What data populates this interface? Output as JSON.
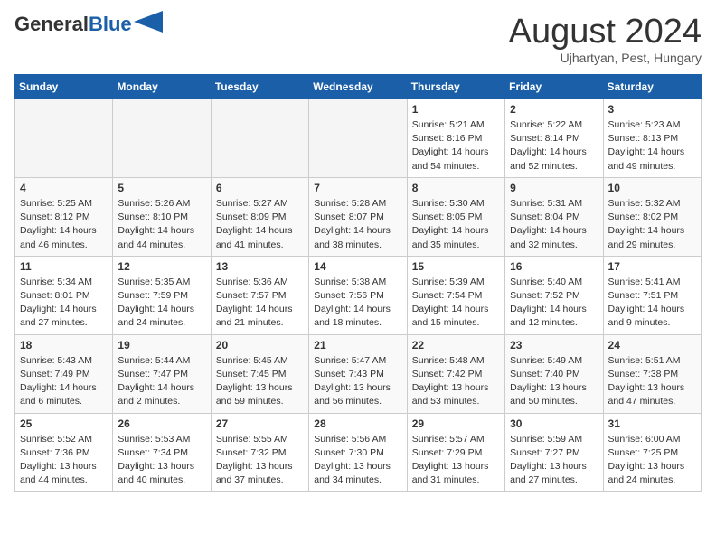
{
  "header": {
    "logo_general": "General",
    "logo_blue": "Blue",
    "month": "August 2024",
    "location": "Ujhartyan, Pest, Hungary"
  },
  "days_of_week": [
    "Sunday",
    "Monday",
    "Tuesday",
    "Wednesday",
    "Thursday",
    "Friday",
    "Saturday"
  ],
  "weeks": [
    [
      {
        "day": "",
        "empty": true
      },
      {
        "day": "",
        "empty": true
      },
      {
        "day": "",
        "empty": true
      },
      {
        "day": "",
        "empty": true
      },
      {
        "day": "1",
        "sunrise": "5:21 AM",
        "sunset": "8:16 PM",
        "daylight": "14 hours and 54 minutes."
      },
      {
        "day": "2",
        "sunrise": "5:22 AM",
        "sunset": "8:14 PM",
        "daylight": "14 hours and 52 minutes."
      },
      {
        "day": "3",
        "sunrise": "5:23 AM",
        "sunset": "8:13 PM",
        "daylight": "14 hours and 49 minutes."
      }
    ],
    [
      {
        "day": "4",
        "sunrise": "5:25 AM",
        "sunset": "8:12 PM",
        "daylight": "14 hours and 46 minutes."
      },
      {
        "day": "5",
        "sunrise": "5:26 AM",
        "sunset": "8:10 PM",
        "daylight": "14 hours and 44 minutes."
      },
      {
        "day": "6",
        "sunrise": "5:27 AM",
        "sunset": "8:09 PM",
        "daylight": "14 hours and 41 minutes."
      },
      {
        "day": "7",
        "sunrise": "5:28 AM",
        "sunset": "8:07 PM",
        "daylight": "14 hours and 38 minutes."
      },
      {
        "day": "8",
        "sunrise": "5:30 AM",
        "sunset": "8:05 PM",
        "daylight": "14 hours and 35 minutes."
      },
      {
        "day": "9",
        "sunrise": "5:31 AM",
        "sunset": "8:04 PM",
        "daylight": "14 hours and 32 minutes."
      },
      {
        "day": "10",
        "sunrise": "5:32 AM",
        "sunset": "8:02 PM",
        "daylight": "14 hours and 29 minutes."
      }
    ],
    [
      {
        "day": "11",
        "sunrise": "5:34 AM",
        "sunset": "8:01 PM",
        "daylight": "14 hours and 27 minutes."
      },
      {
        "day": "12",
        "sunrise": "5:35 AM",
        "sunset": "7:59 PM",
        "daylight": "14 hours and 24 minutes."
      },
      {
        "day": "13",
        "sunrise": "5:36 AM",
        "sunset": "7:57 PM",
        "daylight": "14 hours and 21 minutes."
      },
      {
        "day": "14",
        "sunrise": "5:38 AM",
        "sunset": "7:56 PM",
        "daylight": "14 hours and 18 minutes."
      },
      {
        "day": "15",
        "sunrise": "5:39 AM",
        "sunset": "7:54 PM",
        "daylight": "14 hours and 15 minutes."
      },
      {
        "day": "16",
        "sunrise": "5:40 AM",
        "sunset": "7:52 PM",
        "daylight": "14 hours and 12 minutes."
      },
      {
        "day": "17",
        "sunrise": "5:41 AM",
        "sunset": "7:51 PM",
        "daylight": "14 hours and 9 minutes."
      }
    ],
    [
      {
        "day": "18",
        "sunrise": "5:43 AM",
        "sunset": "7:49 PM",
        "daylight": "14 hours and 6 minutes."
      },
      {
        "day": "19",
        "sunrise": "5:44 AM",
        "sunset": "7:47 PM",
        "daylight": "14 hours and 2 minutes."
      },
      {
        "day": "20",
        "sunrise": "5:45 AM",
        "sunset": "7:45 PM",
        "daylight": "13 hours and 59 minutes."
      },
      {
        "day": "21",
        "sunrise": "5:47 AM",
        "sunset": "7:43 PM",
        "daylight": "13 hours and 56 minutes."
      },
      {
        "day": "22",
        "sunrise": "5:48 AM",
        "sunset": "7:42 PM",
        "daylight": "13 hours and 53 minutes."
      },
      {
        "day": "23",
        "sunrise": "5:49 AM",
        "sunset": "7:40 PM",
        "daylight": "13 hours and 50 minutes."
      },
      {
        "day": "24",
        "sunrise": "5:51 AM",
        "sunset": "7:38 PM",
        "daylight": "13 hours and 47 minutes."
      }
    ],
    [
      {
        "day": "25",
        "sunrise": "5:52 AM",
        "sunset": "7:36 PM",
        "daylight": "13 hours and 44 minutes."
      },
      {
        "day": "26",
        "sunrise": "5:53 AM",
        "sunset": "7:34 PM",
        "daylight": "13 hours and 40 minutes."
      },
      {
        "day": "27",
        "sunrise": "5:55 AM",
        "sunset": "7:32 PM",
        "daylight": "13 hours and 37 minutes."
      },
      {
        "day": "28",
        "sunrise": "5:56 AM",
        "sunset": "7:30 PM",
        "daylight": "13 hours and 34 minutes."
      },
      {
        "day": "29",
        "sunrise": "5:57 AM",
        "sunset": "7:29 PM",
        "daylight": "13 hours and 31 minutes."
      },
      {
        "day": "30",
        "sunrise": "5:59 AM",
        "sunset": "7:27 PM",
        "daylight": "13 hours and 27 minutes."
      },
      {
        "day": "31",
        "sunrise": "6:00 AM",
        "sunset": "7:25 PM",
        "daylight": "13 hours and 24 minutes."
      }
    ]
  ]
}
